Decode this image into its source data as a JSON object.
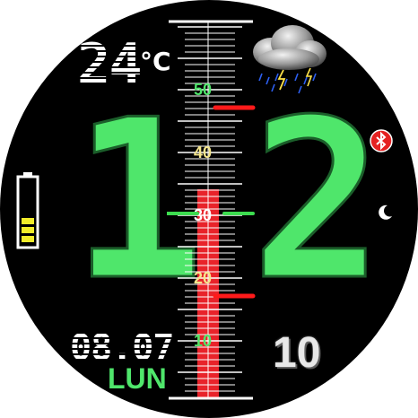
{
  "temperature": {
    "value": "24",
    "unit": "°C"
  },
  "weather": {
    "icon": "thunderstorm-cloud-icon"
  },
  "time": {
    "hour_tens": "1",
    "hour_ones": "2",
    "seconds": "10"
  },
  "date": {
    "day_month": "08.07",
    "weekday": "LUN"
  },
  "status": {
    "bluetooth_icon": "bluetooth-icon",
    "night_icon": "moon-icon",
    "battery_icon": "battery-icon",
    "battery_level": 0.3
  },
  "thermometer": {
    "labels": [
      {
        "text": "50",
        "value": 50,
        "color": "#4fe66b"
      },
      {
        "text": "40",
        "value": 40,
        "color": "#f4e58c"
      },
      {
        "text": "30",
        "value": 30,
        "color": "#ffffff"
      },
      {
        "text": "20",
        "value": 20,
        "color": "#f4e58c"
      },
      {
        "text": "10",
        "value": 10,
        "color": "#4fe66b"
      }
    ],
    "current": 30,
    "fill_value": 34,
    "marker_high": 47,
    "marker_low": 17,
    "colors": {
      "fill": "#e8232a",
      "current_marker": "#3ddc4f",
      "limit_marker": "#ff1a1a"
    }
  }
}
